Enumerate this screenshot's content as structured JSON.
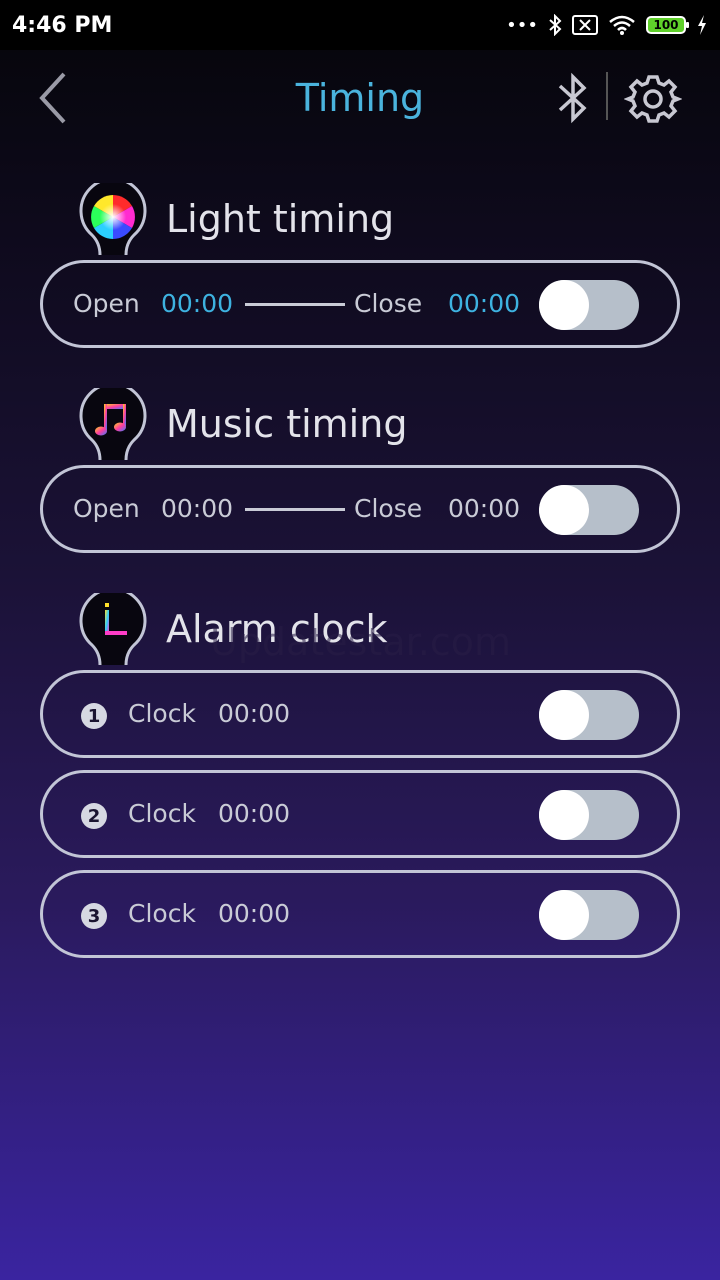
{
  "status_bar": {
    "time": "4:46 PM",
    "battery": "100"
  },
  "header": {
    "title": "Timing",
    "icons": [
      "back-chevron-icon",
      "bluetooth-icon",
      "gear-icon"
    ]
  },
  "light_timing": {
    "title": "Light timing",
    "open_label": "Open",
    "open_time": "00:00",
    "close_label": "Close",
    "close_time": "00:00",
    "enabled": false
  },
  "music_timing": {
    "title": "Music timing",
    "open_label": "Open",
    "open_time": "00:00",
    "close_label": "Close",
    "close_time": "00:00",
    "enabled": false
  },
  "alarm_clock": {
    "title": "Alarm clock",
    "clocks": [
      {
        "number": "1",
        "label": "Clock",
        "time": "00:00",
        "enabled": false
      },
      {
        "number": "2",
        "label": "Clock",
        "time": "00:00",
        "enabled": false
      },
      {
        "number": "3",
        "label": "Clock",
        "time": "00:00",
        "enabled": false
      }
    ]
  },
  "watermark": "Updatestar.com",
  "colors": {
    "accent": "#3eb2e0",
    "pill_border": "#c2c5d6",
    "toggle_off": "#b6bfca"
  }
}
